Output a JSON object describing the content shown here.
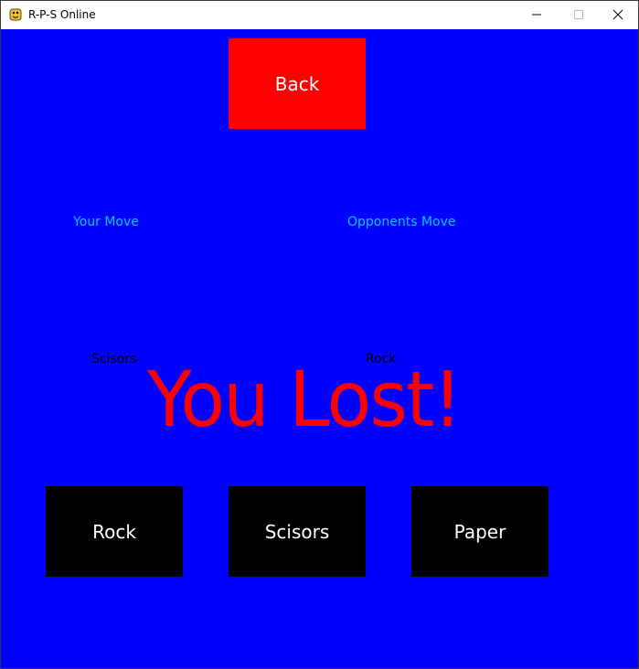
{
  "window": {
    "title": "R-P-S Online",
    "icon": "python-snake-icon",
    "controls": {
      "minimize_icon": "minimize-icon",
      "maximize_icon": "maximize-icon",
      "close_icon": "close-icon"
    }
  },
  "game": {
    "background_color": "#0000ff",
    "back_button": {
      "label": "Back",
      "color": "#ff0000"
    },
    "your_move": {
      "label": "Your Move",
      "value": "Scisors"
    },
    "opponent_move": {
      "label": "Opponents Move",
      "value": "Rock"
    },
    "result_text": "You Lost!",
    "result_color": "#ff0000",
    "choices": [
      {
        "label": "Rock"
      },
      {
        "label": "Scisors"
      },
      {
        "label": "Paper"
      }
    ]
  }
}
